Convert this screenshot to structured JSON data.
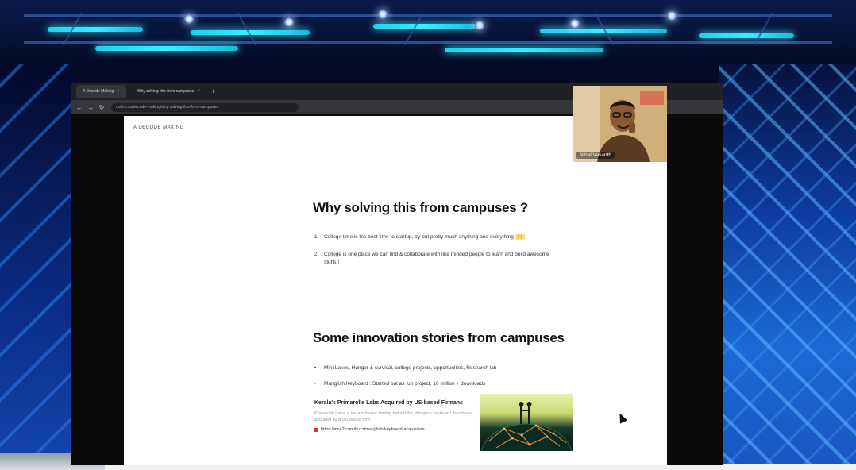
{
  "screen": {
    "browser": {
      "tabs": [
        {
          "label": "A Decode Making",
          "active": true
        },
        {
          "label": "Why solving this from campuses",
          "active": false
        }
      ],
      "url": "notion.so/decode-making/why-solving-this-from-campuses"
    },
    "page": {
      "breadcrumb": "A DECODE MAKING",
      "section1": {
        "title": "Why solving this from campuses ?",
        "items": [
          {
            "marker": "1.",
            "text": "College time is the best time to startup, try out pretty much anything and everything",
            "emoji": "🙌"
          },
          {
            "marker": "2.",
            "text": "College is one place we can find & collaborate with like minded people to learn and build awesome stuffs !"
          }
        ]
      },
      "section2": {
        "title": "Some innovation stories from campuses",
        "items": [
          {
            "marker": "•",
            "text": "Mini Lakes, Hunger & survival, college projects, opportunities, Research lab"
          },
          {
            "marker": "•",
            "text": "Manglish Keyboard : Started out as fun project, 10 million + downloads"
          }
        ],
        "link_card": {
          "title": "Kerala's Primarolle Labs Acquired by US-based Firmans",
          "description": "Primarolle Labs, a Kerala-based startup behind the Manglish keyboard, has been acquired by a US-based firm.",
          "url": "https://inc42.com/buzz/manglish-keyboard-acquisition"
        }
      }
    }
  },
  "webcam": {
    "name": "Nihal Vasanth"
  },
  "colors": {
    "truss_light": "#36f0ff",
    "stage_blue": "#1b6ad6",
    "highlight": "#ffe27a"
  },
  "icons": {
    "back": "←",
    "forward": "→",
    "reload": "↻",
    "new_tab": "+",
    "tab_close": "×"
  }
}
